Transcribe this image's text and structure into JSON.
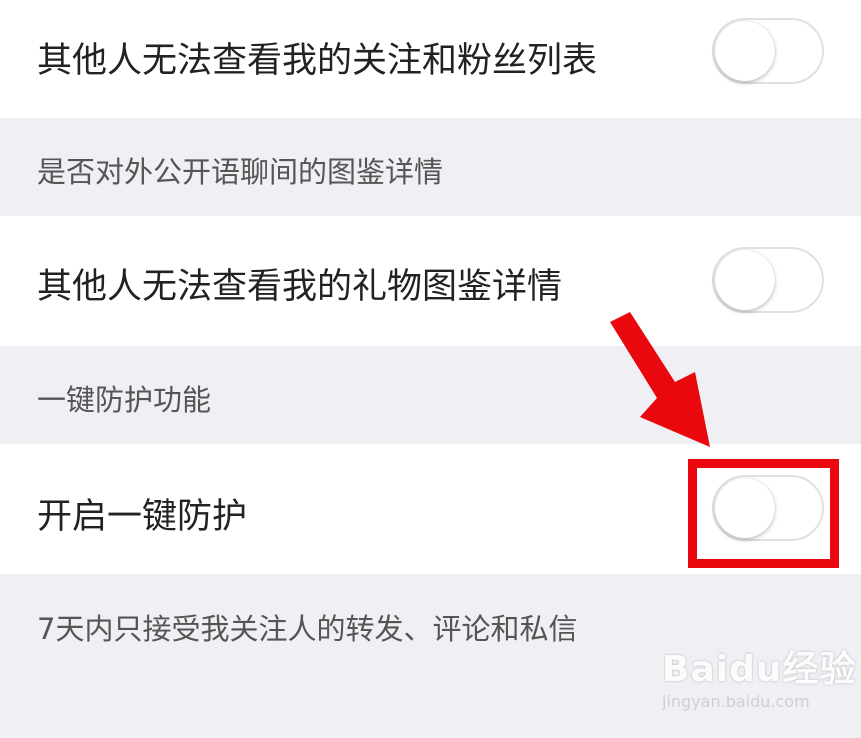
{
  "rows": [
    {
      "label": "其他人无法查看我的关注和粉丝列表",
      "toggle_on": false
    },
    {
      "label": "其他人无法查看我的礼物图鉴详情",
      "toggle_on": false
    },
    {
      "label": "开启一键防护",
      "toggle_on": false
    }
  ],
  "headers": [
    {
      "text": "是否对外公开语聊间的图鉴详情"
    },
    {
      "text": "一键防护功能"
    }
  ],
  "footer": {
    "text": "7天内只接受我关注人的转发、评论和私信"
  },
  "annotation": {
    "color": "#e8080e"
  },
  "watermark": {
    "brand": "Baidu经验",
    "url": "jingyan.baidu.com"
  }
}
